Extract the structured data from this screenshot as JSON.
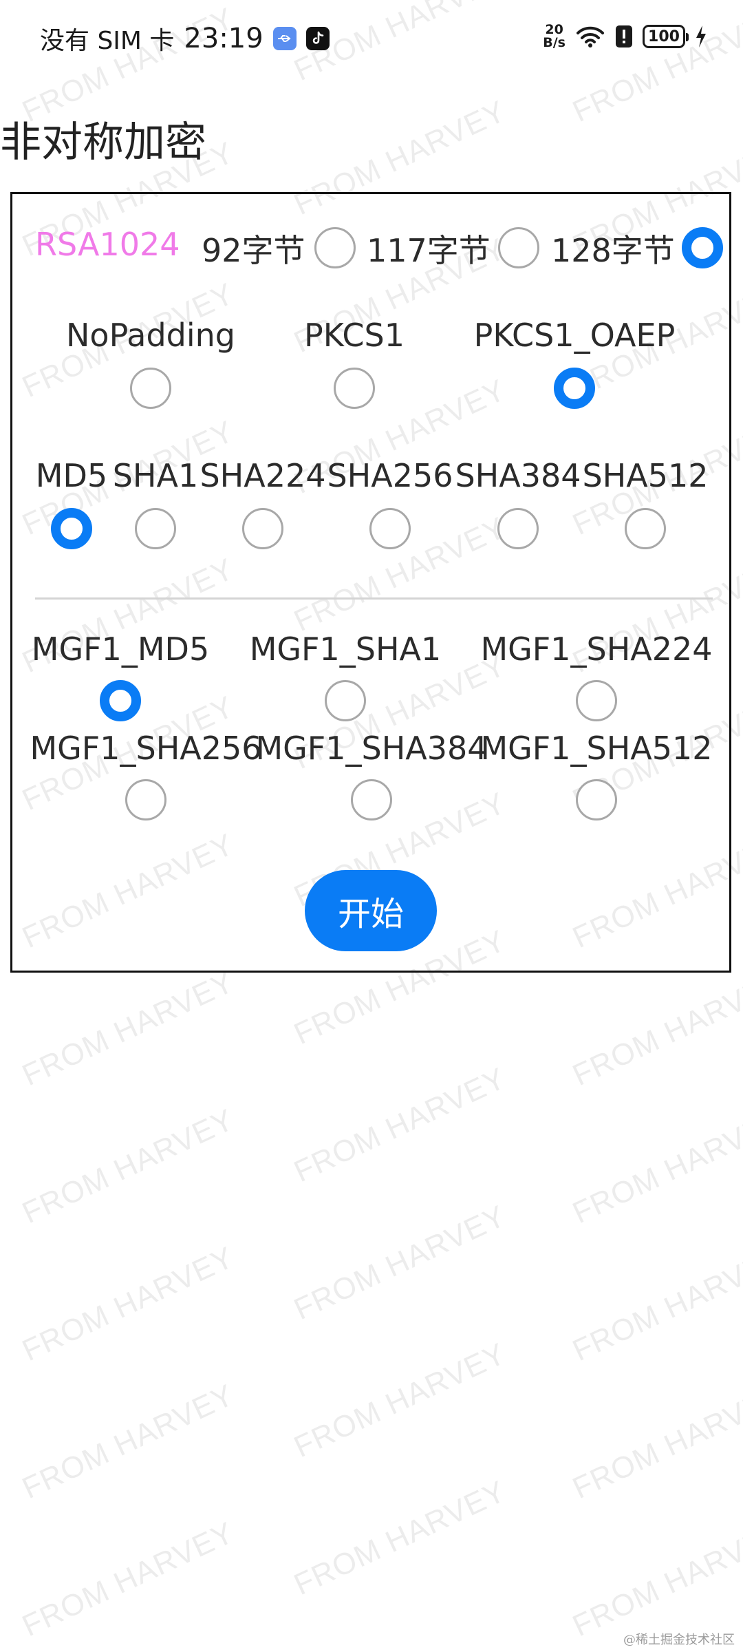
{
  "status_bar": {
    "carrier": "没有 SIM 卡",
    "time": "23:19",
    "net_speed_value": "20",
    "net_speed_unit": "B/s",
    "battery": "100",
    "icons": [
      "usb-icon",
      "tiktok-icon",
      "wifi-icon",
      "alert-icon",
      "battery-icon",
      "charging-icon"
    ]
  },
  "page": {
    "title": "非对称加密"
  },
  "key_size": {
    "algorithm": "RSA1024",
    "options": [
      {
        "label": "92字节",
        "checked": false
      },
      {
        "label": "117字节",
        "checked": false
      },
      {
        "label": "128字节",
        "checked": true
      }
    ]
  },
  "padding": {
    "options": [
      {
        "label": "NoPadding",
        "checked": false
      },
      {
        "label": "PKCS1",
        "checked": false
      },
      {
        "label": "PKCS1_OAEP",
        "checked": true
      }
    ]
  },
  "digest": {
    "options": [
      {
        "label": "MD5",
        "checked": true
      },
      {
        "label": "SHA1",
        "checked": false
      },
      {
        "label": "SHA224",
        "checked": false
      },
      {
        "label": "SHA256",
        "checked": false
      },
      {
        "label": "SHA384",
        "checked": false
      },
      {
        "label": "SHA512",
        "checked": false
      }
    ]
  },
  "mgf": {
    "options": [
      {
        "label": "MGF1_MD5",
        "checked": true
      },
      {
        "label": "MGF1_SHA1",
        "checked": false
      },
      {
        "label": "MGF1_SHA224",
        "checked": false
      },
      {
        "label": "MGF1_SHA256",
        "checked": false
      },
      {
        "label": "MGF1_SHA384",
        "checked": false
      },
      {
        "label": "MGF1_SHA512",
        "checked": false
      }
    ]
  },
  "actions": {
    "start_label": "开始"
  },
  "watermark": {
    "text": "FROM HARVEY"
  },
  "footer": {
    "source_mark": "@稀土掘金技术社区"
  },
  "colors": {
    "accent": "#0a7cf5",
    "algorithm_label": "#f07ae8"
  }
}
